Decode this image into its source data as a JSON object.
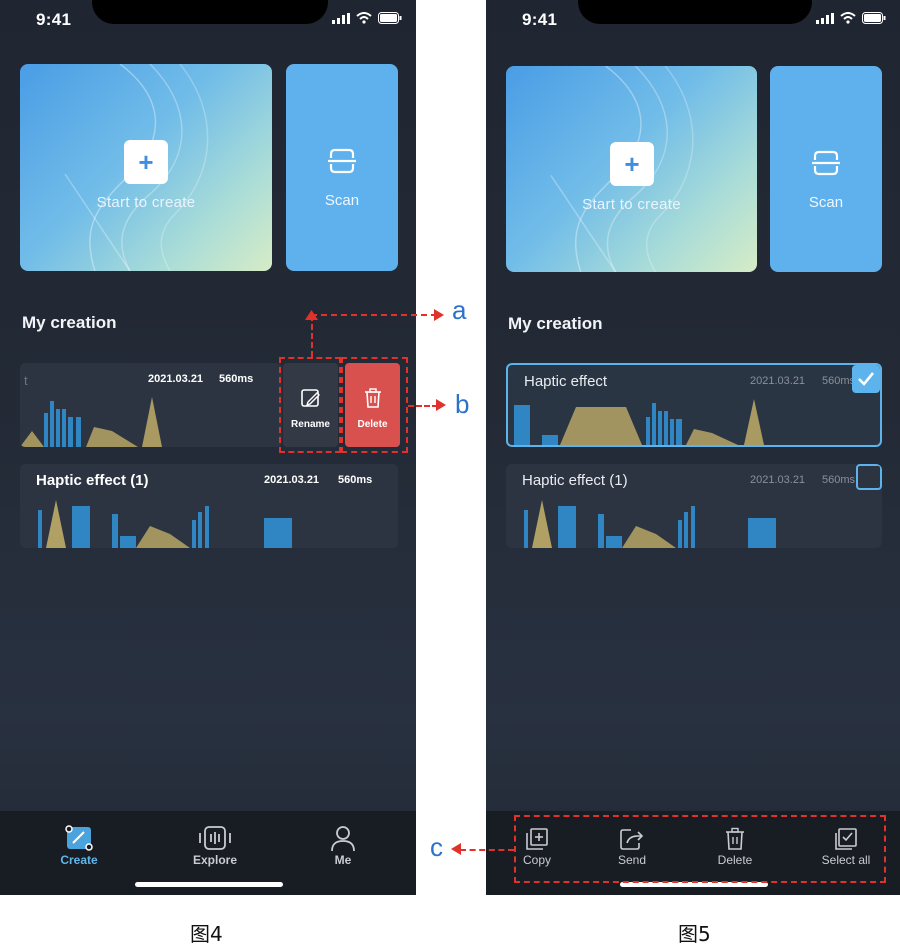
{
  "status": {
    "time": "9:41"
  },
  "screen1": {
    "create_label": "Start to create",
    "scan_label": "Scan",
    "section_title": "My creation",
    "items": [
      {
        "title": "t",
        "date": "2021.03.21",
        "duration": "560ms"
      },
      {
        "title": "Haptic effect (1)",
        "date": "2021.03.21",
        "duration": "560ms"
      }
    ],
    "swipe_actions": {
      "rename": "Rename",
      "delete": "Delete"
    },
    "tabs": [
      {
        "label": "Create",
        "icon": "create-icon",
        "active": true
      },
      {
        "label": "Explore",
        "icon": "explore-icon",
        "active": false
      },
      {
        "label": "Me",
        "icon": "person-icon",
        "active": false
      }
    ],
    "caption": "图4"
  },
  "screen2": {
    "create_label": "Start to create",
    "scan_label": "Scan",
    "section_title": "My creation",
    "items": [
      {
        "title": "Haptic effect",
        "date": "2021.03.21",
        "duration": "560ms",
        "selected": true
      },
      {
        "title": "Haptic effect (1)",
        "date": "2021.03.21",
        "duration": "560ms",
        "selected": false
      }
    ],
    "actions": [
      {
        "label": "Copy",
        "icon": "copy-icon"
      },
      {
        "label": "Send",
        "icon": "send-icon"
      },
      {
        "label": "Delete",
        "icon": "trash-icon"
      },
      {
        "label": "Select all",
        "icon": "select-all-icon"
      }
    ],
    "caption": "图5"
  },
  "annotations": {
    "a": "a",
    "b": "b",
    "c": "c"
  },
  "colors": {
    "accent": "#5eb7ec",
    "danger": "#d9514e",
    "annotation": "#e0312b",
    "annotation_letter": "#2b73c9"
  }
}
